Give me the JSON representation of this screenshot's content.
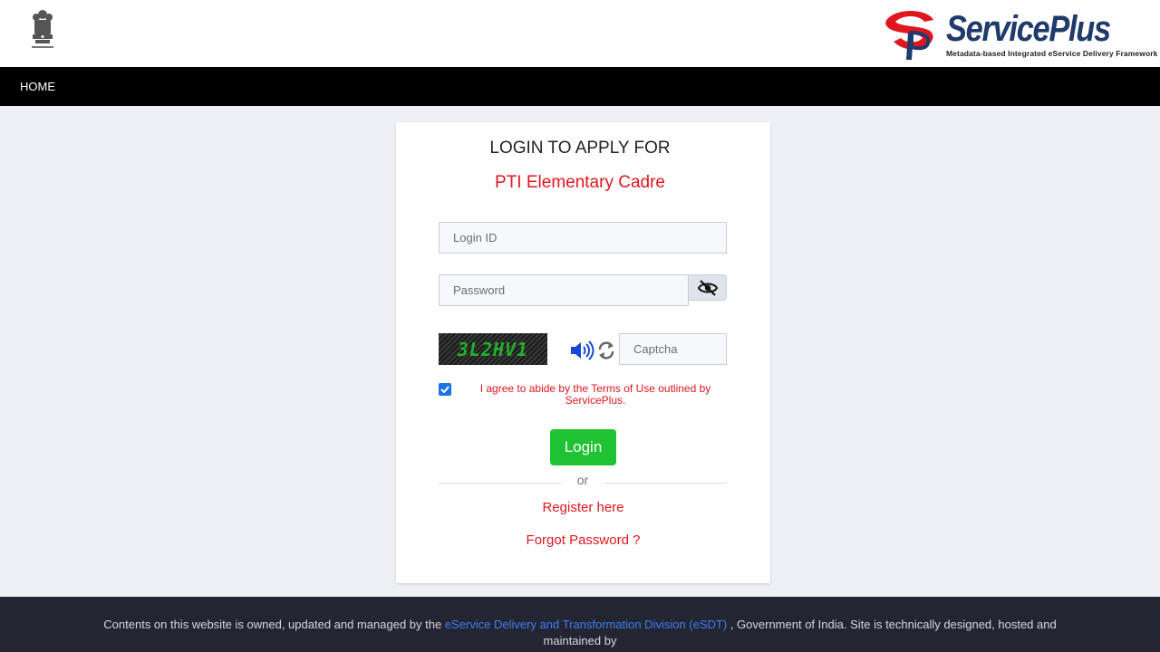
{
  "header": {
    "emblem_icon": "national-emblem-icon",
    "brand_name": "ServicePlus",
    "brand_tagline": "Metadata-based Integrated eService Delivery Framework",
    "brand_colors": {
      "name": "#1f3a6b",
      "logo": "#e0161f"
    }
  },
  "nav": {
    "home_label": "HOME"
  },
  "login": {
    "title": "LOGIN TO APPLY FOR",
    "subtitle": "PTI Elementary Cadre",
    "login_id_placeholder": "Login ID",
    "password_placeholder": "Password",
    "eye_icon": "eye-slash-icon",
    "captcha_text": "3L2HV1",
    "speaker_icon": "speaker-icon",
    "refresh_icon": "refresh-icon",
    "captcha_placeholder": "Captcha",
    "terms_checked": true,
    "terms_text": "I agree to abide by the Terms of Use outlined by ServicePlus.",
    "login_button": "Login",
    "divider_text": "or",
    "register_link": "Register here",
    "forgot_link": "Forgot Password ?"
  },
  "colors": {
    "accent_red": "#e0161f",
    "login_green": "#1fc232",
    "nav_bg": "#000000",
    "footer_bg": "#242533",
    "link_blue": "#3d7ff0"
  },
  "footer": {
    "text_before": "Contents on this website is owned, updated and managed by the ",
    "link_text": "eService Delivery and Transformation Division (eSDT)",
    "text_after": " , Government of India. Site is technically designed, hosted and maintained by"
  }
}
